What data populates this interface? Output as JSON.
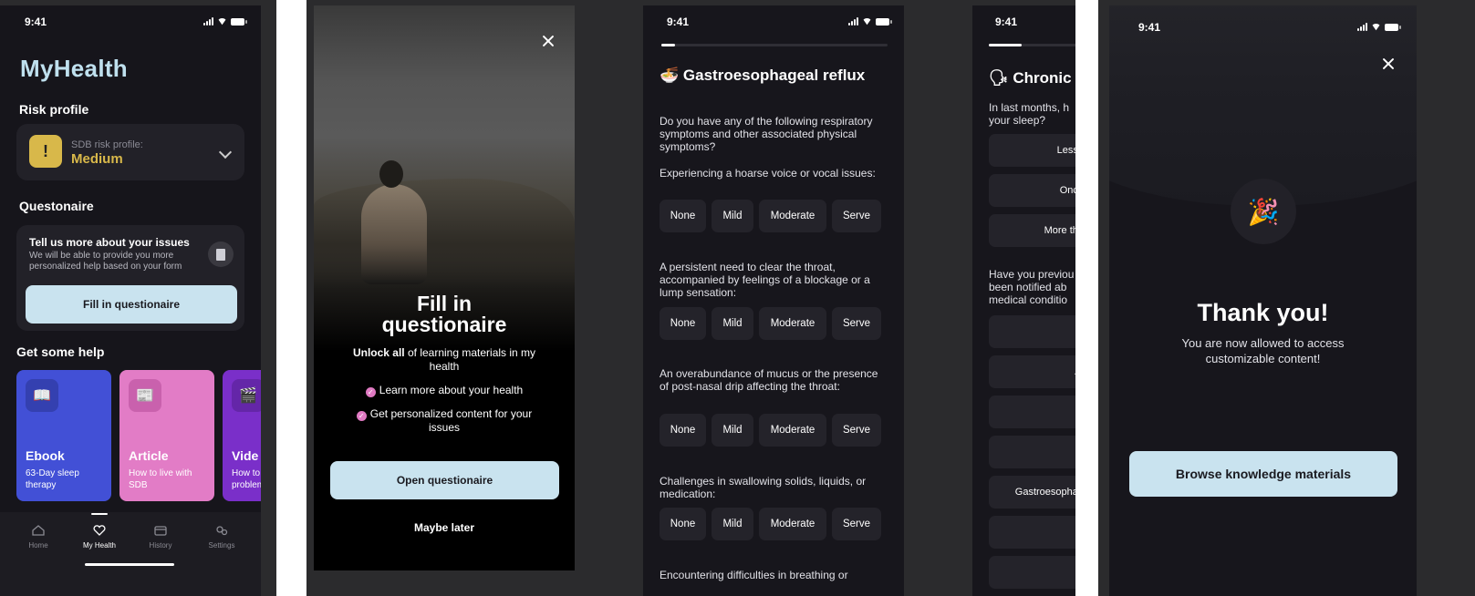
{
  "status_time": "9:41",
  "screen1": {
    "app_title": "MyHealth",
    "risk_section": "Risk profile",
    "risk_label": "SDB risk profile:",
    "risk_value": "Medium",
    "questionnaire_section": "Questonaire",
    "q_card_title": "Tell us more about your issues",
    "q_card_desc": "We will be able to provide you more personalized help based on your form",
    "q_button": "Fill in questionaire",
    "help_section": "Get some help",
    "help_cards": [
      {
        "title": "Ebook",
        "subtitle": "63-Day sleep therapy",
        "icon": "book-icon",
        "color": "#4250d6"
      },
      {
        "title": "Article",
        "subtitle": "How to live with SDB",
        "icon": "newspaper-icon",
        "color": "#e27cc6"
      },
      {
        "title": "Vide",
        "subtitle": "How to problem",
        "icon": "video-icon",
        "color": "#7a2fc9"
      }
    ],
    "tabs": [
      {
        "label": "Home",
        "icon": "home-icon"
      },
      {
        "label": "My Health",
        "icon": "heart-icon"
      },
      {
        "label": "History",
        "icon": "calendar-icon"
      },
      {
        "label": "Settings",
        "icon": "gear-icon"
      }
    ]
  },
  "screen2": {
    "title": "Fill in questionaire",
    "unlock_bold": "Unlock all",
    "unlock_rest": " of learning materials in my health",
    "checks": [
      "Learn more about your health",
      "Get personalized content for your issues"
    ],
    "primary_button": "Open questionaire",
    "secondary_button": "Maybe later"
  },
  "screen3": {
    "progress": 0.06,
    "heading": "Gastroesophageal reflux",
    "heading_icon": "🍜",
    "intro": "Do you have any of the following respiratory symptoms and other associated physical symptoms?",
    "options": [
      "None",
      "Mild",
      "Moderate",
      "Serve"
    ],
    "questions": [
      "Experiencing a hoarse voice or vocal issues:",
      "A persistent need to clear the throat, accompanied by feelings of a blockage or a lump sensation:",
      "An overabundance of mucus or the presence of post-nasal drip affecting the throat:",
      "Challenges in swallowing solids, liquids, or medication:",
      "Encountering difficulties in breathing or"
    ]
  },
  "screen4": {
    "progress": 0.3,
    "heading": "Chronic c",
    "heading_icon": "🗣",
    "q1": "In last months, h",
    "q1b": "your sleep?",
    "opts1": [
      "Less t",
      "Once",
      "More tha"
    ],
    "q2": "Have you previou",
    "q2b": "been notified ab",
    "q2c": "medical conditio",
    "opts2": [
      "",
      "Al",
      "",
      "",
      "Gastroesophag",
      "F",
      ""
    ]
  },
  "screen5": {
    "title": "Thank you!",
    "subtitle": "You are now allowed to access customizable content!",
    "button": "Browse knowledge materials",
    "icon": "🎉"
  }
}
